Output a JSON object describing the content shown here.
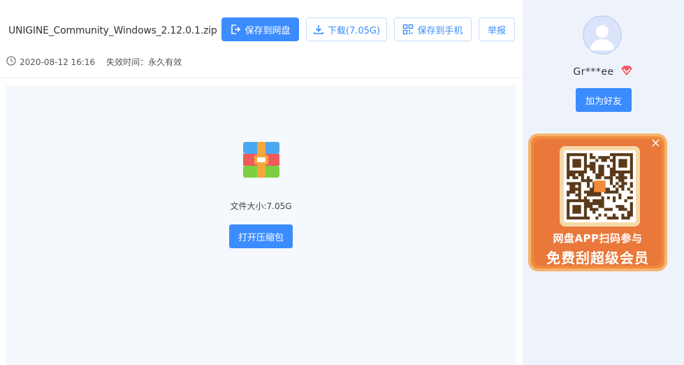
{
  "file": {
    "name": "UNIGINE_Community_Windows_2.12.0.1.zip",
    "date": "2020-08-12 16:16",
    "expire": "失效时间：永久有效"
  },
  "actions": {
    "save_to_disk": "保存到网盘",
    "download": "下载(7.05G)",
    "save_to_phone": "保存到手机",
    "report": "举报"
  },
  "preview": {
    "file_size": "文件大小:7.05G",
    "open_archive": "打开压缩包"
  },
  "sidebar": {
    "username": "Gr***ee",
    "add_friend": "加为好友",
    "promo_line1": "网盘APP扫码参与",
    "promo_line2": "免费刮超级会员",
    "promo_close": "×"
  },
  "colors": {
    "accent": "#3b8cff",
    "sidebar_bg": "#eef3fb",
    "promo_orange": "#f08a3c"
  },
  "icons": [
    "save-icon",
    "download-icon",
    "qrcode-icon",
    "clock-icon",
    "zip-archive-icon",
    "user-avatar-icon",
    "vip-diamond-icon",
    "close-icon",
    "qr-code-image"
  ]
}
